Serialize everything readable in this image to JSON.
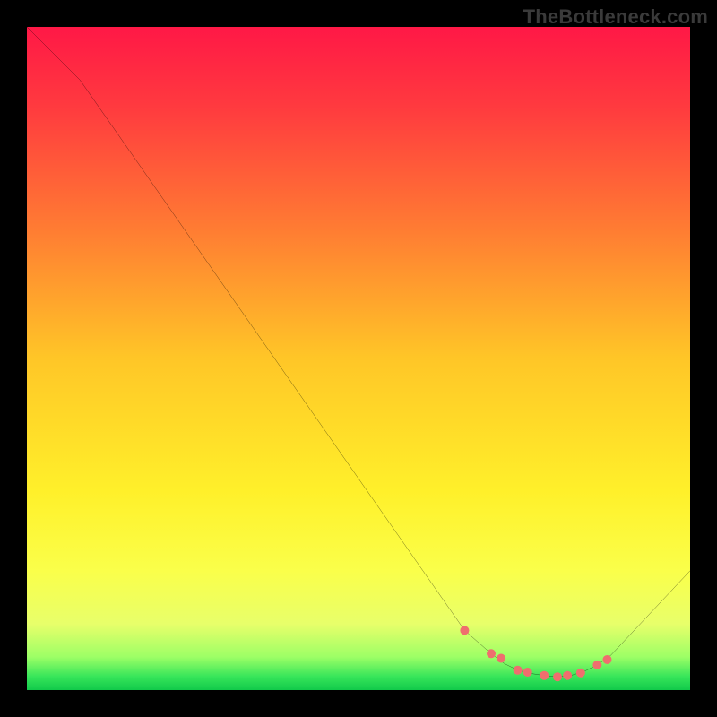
{
  "watermark": "TheBottleneck.com",
  "gradient_stops": [
    {
      "pct": 0,
      "color": "#ff1846"
    },
    {
      "pct": 12,
      "color": "#ff3a3f"
    },
    {
      "pct": 30,
      "color": "#ff7a33"
    },
    {
      "pct": 50,
      "color": "#ffc627"
    },
    {
      "pct": 70,
      "color": "#fff02a"
    },
    {
      "pct": 82,
      "color": "#faff4a"
    },
    {
      "pct": 90,
      "color": "#e8ff6a"
    },
    {
      "pct": 95,
      "color": "#9dff66"
    },
    {
      "pct": 98,
      "color": "#36e55a"
    },
    {
      "pct": 100,
      "color": "#11c94a"
    }
  ],
  "chart_data": {
    "type": "line",
    "title": "",
    "xlabel": "",
    "ylabel": "",
    "xlim": [
      0,
      100
    ],
    "ylim": [
      0,
      100
    ],
    "series": [
      {
        "name": "bottleneck-curve",
        "color": "#000000",
        "x": [
          0,
          8,
          66,
          70,
          72,
          74,
          76,
          78,
          80,
          82,
          84,
          86,
          88,
          100
        ],
        "y": [
          100,
          92,
          9,
          5.5,
          4,
          3,
          2.5,
          2.2,
          2,
          2.2,
          2.8,
          3.8,
          5.2,
          18
        ]
      }
    ],
    "markers": {
      "name": "highlight-band",
      "color": "#ef6e6e",
      "radius": 5,
      "x": [
        66,
        70,
        71.5,
        74,
        75.5,
        78,
        80,
        81.5,
        83.5,
        86,
        87.5
      ],
      "y": [
        9,
        5.5,
        4.8,
        3,
        2.7,
        2.2,
        2,
        2.2,
        2.6,
        3.8,
        4.6
      ]
    }
  }
}
